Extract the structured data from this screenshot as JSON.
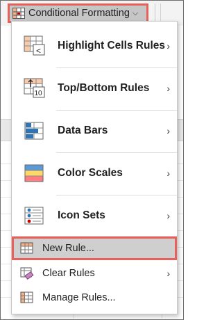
{
  "ribbon": {
    "button_label": "Conditional Formatting",
    "chevron": "chevron-down-icon"
  },
  "menu": {
    "big_items": [
      {
        "label": "Highlight Cells Rules",
        "icon": "highlight-cells-rules-icon",
        "badge": "<"
      },
      {
        "label": "Top/Bottom Rules",
        "icon": "top-bottom-rules-icon",
        "badge": "10"
      },
      {
        "label": "Data Bars",
        "icon": "data-bars-icon"
      },
      {
        "label": "Color Scales",
        "icon": "color-scales-icon"
      },
      {
        "label": "Icon Sets",
        "icon": "icon-sets-icon"
      }
    ],
    "small_items": [
      {
        "label": "New Rule...",
        "icon": "new-rule-icon",
        "selected": true
      },
      {
        "label": "Clear Rules",
        "icon": "clear-rules-icon",
        "submenu": true
      },
      {
        "label": "Manage Rules...",
        "icon": "manage-rules-icon"
      }
    ],
    "submenu_chevron": "›"
  },
  "colors": {
    "highlight_border": "#e8605a",
    "selected_bg": "#cfcfcf",
    "accent_blue": "#2e75b6",
    "accent_orange": "#f4a460"
  }
}
